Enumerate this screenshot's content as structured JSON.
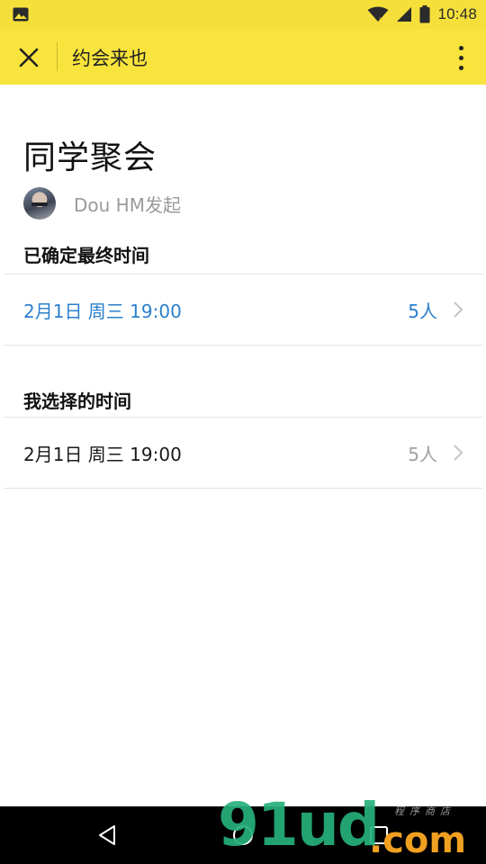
{
  "status_bar": {
    "time": "10:48",
    "icons": [
      "image-icon",
      "wifi-icon",
      "signal-icon",
      "battery-icon"
    ]
  },
  "app_bar": {
    "title": "约会来也",
    "close_icon": "close-icon",
    "more_icon": "more-vertical-icon",
    "background": "#f8e43c"
  },
  "event": {
    "title": "同学聚会",
    "organizer": "Dou HM发起"
  },
  "final_time_section": {
    "heading": "已确定最终时间",
    "time": "2月1日 周三 19:00",
    "count": "5人",
    "accent": "#2b7fcc"
  },
  "my_time_section": {
    "heading": "我选择的时间",
    "time": "2月1日 周三 19:00",
    "count": "5人"
  },
  "nav_bar": {
    "buttons": [
      "back-icon",
      "home-icon",
      "recents-icon"
    ]
  },
  "watermark": {
    "logo": "91ud",
    "domain": ".com",
    "tagline": "程序商店"
  }
}
